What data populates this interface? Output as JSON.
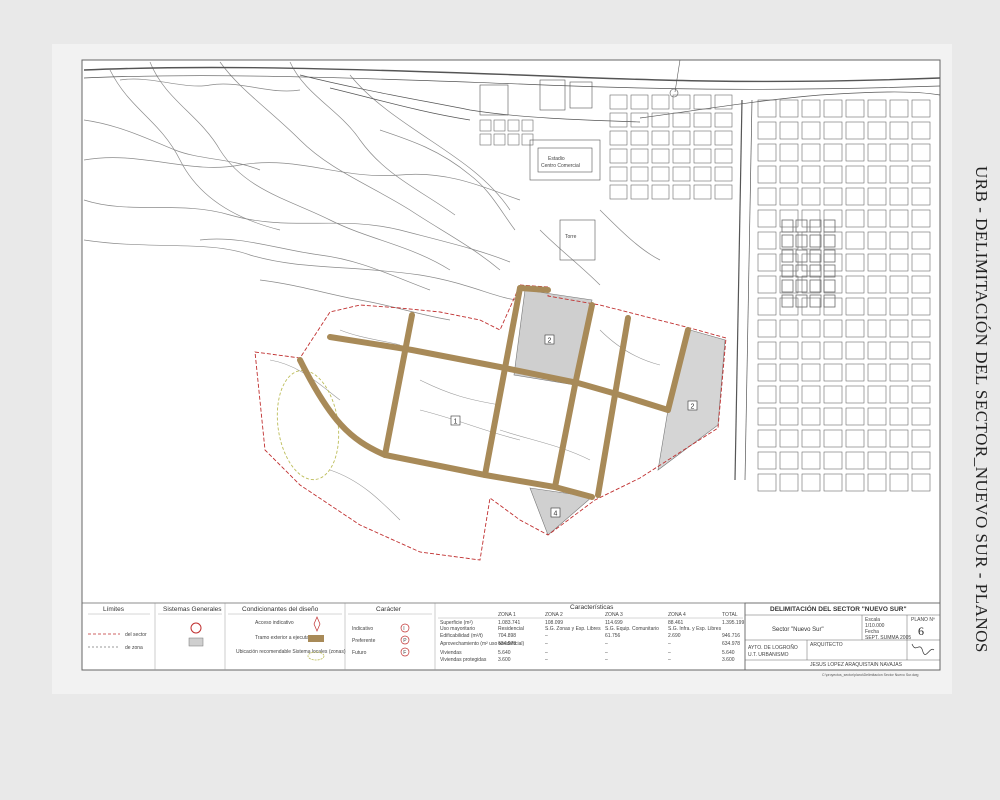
{
  "side_caption": "URB - DELIMITACIÓN DEL SECTOR_NUEVO SUR - PLANOS",
  "map": {
    "zone_labels": [
      "1",
      "2",
      "2",
      "4"
    ],
    "place_labels": {
      "park": "Parque",
      "estadio": "Estadio",
      "centro": "Centro Comercial",
      "torre": "Torre"
    }
  },
  "legend": {
    "limites": {
      "header": "Límites",
      "items": [
        {
          "label": "del sector"
        },
        {
          "label": "de zona"
        }
      ]
    },
    "sistemas": {
      "header": "Sistemas Generales"
    },
    "condicionantes": {
      "header": "Condicionantes del diseño",
      "items": [
        {
          "label": "Acceso indicativo"
        },
        {
          "label": "Tramo exterior a ejecutar"
        },
        {
          "label": "Ubicación recomendable Sistema locales (zonas)"
        }
      ]
    },
    "caracter": {
      "header": "Carácter",
      "items": [
        {
          "label": "Indicativo",
          "code": "I"
        },
        {
          "label": "Preferente",
          "code": "P"
        },
        {
          "label": "Futuro",
          "code": "F"
        }
      ]
    },
    "caracteristicas": {
      "header": "Características",
      "columns": [
        "",
        "ZONA 1",
        "ZONA 2",
        "ZONA 3",
        "ZONA 4",
        "TOTAL"
      ],
      "rows": [
        [
          "Superficie (m²)",
          "1.083.741",
          "108.099",
          "114.699",
          "88.461",
          "1.395.199"
        ],
        [
          "Uso mayoritario",
          "Residencial",
          "S.G. Zonas y Esp. Libres",
          "S.G. Equip. Comunitario",
          "S.G. Infra. y Esp. Libres",
          ""
        ],
        [
          "Edificabilidad (m²/t)",
          "704.898",
          "–",
          "61.756",
          "2.690",
          "946.716"
        ],
        [
          "Aprovechamiento (m² uso residencial)",
          "634.978",
          "–",
          "–",
          "–",
          "634.978"
        ],
        [
          "Viviendas",
          "5.640",
          "–",
          "–",
          "–",
          "5.640"
        ],
        [
          "Viviendas protegidas",
          "3.600",
          "–",
          "–",
          "–",
          "3.600"
        ]
      ]
    }
  },
  "title_block": {
    "title": "DELIMITACIÓN DEL SECTOR \"NUEVO SUR\"",
    "plano_label": "PLANO Nº",
    "plano_number": "6",
    "sector": "Sector \"Nuevo Sur\"",
    "escala_label": "Escala",
    "escala": "1/10.000",
    "fecha_label": "Fecha",
    "fecha": "SEPT. SUMMA 2005",
    "client_line1": "AYTO. DE LOGROÑO",
    "client_line2": "U.T. URBANISMO",
    "arquitecto_label": "ARQUITECTO",
    "arquitecto": "JESUS LOPEZ ARAQUISTAIN NAVAJAS",
    "file": "C:\\proyectos_sector\\plano\\Delimitacion Sector Nuevo Sur.dwg"
  },
  "colors": {
    "road": "#a88a58",
    "boundary": "#c03030",
    "zone_fill": "#cfcfcf",
    "park_outline": "#bdbd5a"
  }
}
